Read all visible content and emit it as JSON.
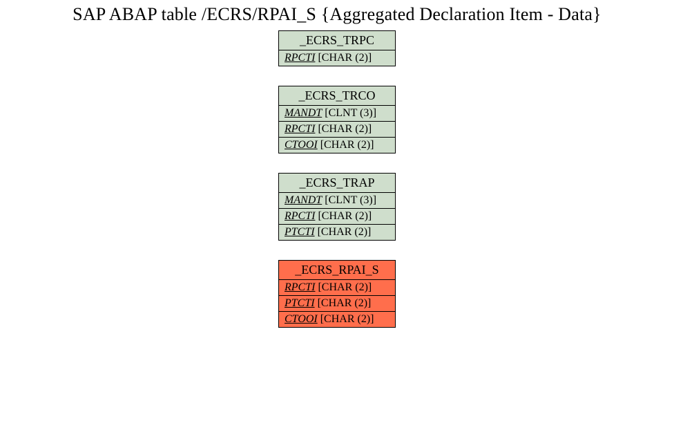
{
  "title": "SAP ABAP table /ECRS/RPAI_S {Aggregated Declaration Item - Data}",
  "entities": [
    {
      "name": "_ECRS_TRPC",
      "color": "green",
      "fields": [
        {
          "name": "RPCTI",
          "type": "[CHAR (2)]"
        }
      ]
    },
    {
      "name": "_ECRS_TRCO",
      "color": "green",
      "fields": [
        {
          "name": "MANDT",
          "type": "[CLNT (3)]"
        },
        {
          "name": "RPCTI",
          "type": "[CHAR (2)]"
        },
        {
          "name": "CTOOI",
          "type": "[CHAR (2)]"
        }
      ]
    },
    {
      "name": "_ECRS_TRAP",
      "color": "green",
      "fields": [
        {
          "name": "MANDT",
          "type": "[CLNT (3)]"
        },
        {
          "name": "RPCTI",
          "type": "[CHAR (2)]"
        },
        {
          "name": "PTCTI",
          "type": "[CHAR (2)]"
        }
      ]
    },
    {
      "name": "_ECRS_RPAI_S",
      "color": "orange",
      "fields": [
        {
          "name": "RPCTI",
          "type": "[CHAR (2)]"
        },
        {
          "name": "PTCTI",
          "type": "[CHAR (2)]"
        },
        {
          "name": "CTOOI",
          "type": "[CHAR (2)]"
        }
      ]
    }
  ]
}
